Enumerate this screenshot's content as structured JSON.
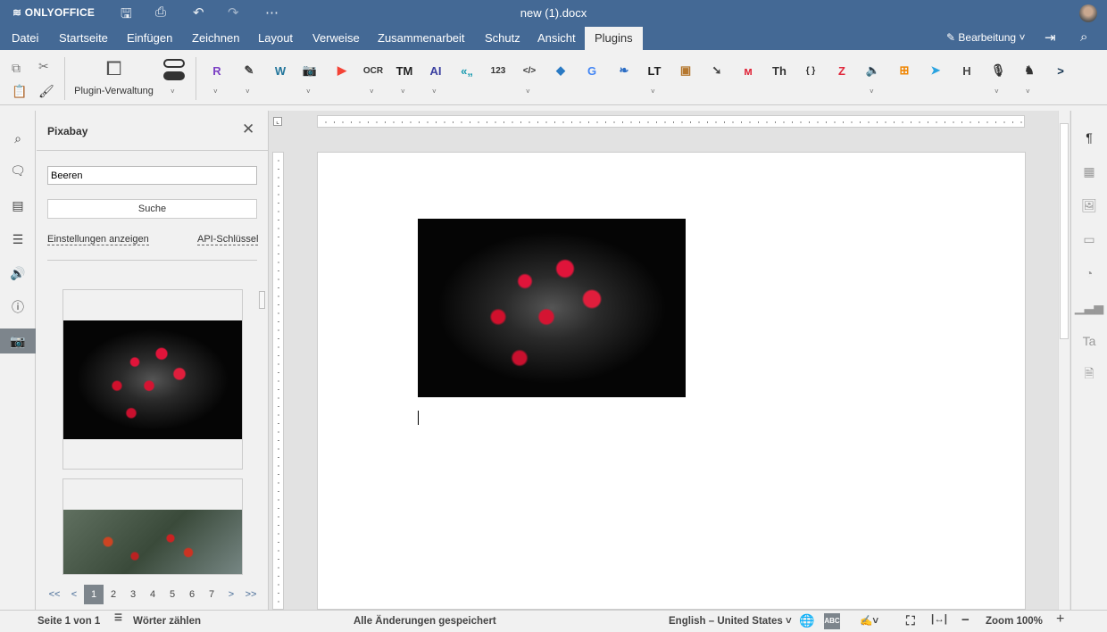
{
  "header": {
    "logo": "ONLYOFFICE",
    "title": "new (1).docx",
    "mode": "Bearbeitung"
  },
  "menu": [
    "Datei",
    "Startseite",
    "Einfügen",
    "Zeichnen",
    "Layout",
    "Verweise",
    "Zusammenarbeit",
    "Schutz",
    "Ansicht",
    "Plugins"
  ],
  "active_menu": "Plugins",
  "toolbar": {
    "plugin_manager": "Plugin-Verwaltung",
    "plugins": [
      {
        "name": "rainbow-r",
        "glyph": "R",
        "color": "#7b3fc4"
      },
      {
        "name": "photo-editor",
        "glyph": "✎",
        "color": "#444"
      },
      {
        "name": "wordpress",
        "glyph": "W",
        "color": "#21759b"
      },
      {
        "name": "camera",
        "glyph": "📷",
        "color": "#333"
      },
      {
        "name": "youtube",
        "glyph": "▶",
        "color": "#f44336"
      },
      {
        "name": "ocr",
        "glyph": "OCR",
        "color": "#333"
      },
      {
        "name": "translator-tm",
        "glyph": "TM",
        "color": "#222"
      },
      {
        "name": "ai",
        "glyph": "AI",
        "color": "#3a3fa0"
      },
      {
        "name": "typograf",
        "glyph": "«„",
        "color": "#1a9bb0"
      },
      {
        "name": "line-numbers",
        "glyph": "123",
        "color": "#333"
      },
      {
        "name": "macros-sync",
        "glyph": "</>",
        "color": "#333"
      },
      {
        "name": "apertium",
        "glyph": "◆",
        "color": "#2a7ac4"
      },
      {
        "name": "google-translate",
        "glyph": "G",
        "color": "#4285f4"
      },
      {
        "name": "deepl",
        "glyph": "❧",
        "color": "#2a6cc4"
      },
      {
        "name": "languagetool",
        "glyph": "LT",
        "color": "#222"
      },
      {
        "name": "box",
        "glyph": "▣",
        "color": "#b5772e"
      },
      {
        "name": "pipe",
        "glyph": "➘",
        "color": "#444"
      },
      {
        "name": "mendeley",
        "glyph": "ᴍ",
        "color": "#e0263a"
      },
      {
        "name": "thesaurus",
        "glyph": "Th",
        "color": "#333"
      },
      {
        "name": "code",
        "glyph": "{ }",
        "color": "#333"
      },
      {
        "name": "zotero",
        "glyph": "Z",
        "color": "#e0263a"
      },
      {
        "name": "speech",
        "glyph": "🔈",
        "color": "#333"
      },
      {
        "name": "drawio",
        "glyph": "⊞",
        "color": "#f08705"
      },
      {
        "name": "telegram",
        "glyph": "➤",
        "color": "#2aa3e0"
      },
      {
        "name": "html",
        "glyph": "H",
        "color": "#444"
      },
      {
        "name": "microphone",
        "glyph": "🎙",
        "color": "#333"
      },
      {
        "name": "chess",
        "glyph": "♞",
        "color": "#333"
      },
      {
        "name": "jitsi",
        "glyph": ">",
        "color": "#12324f"
      }
    ]
  },
  "panel": {
    "title": "Pixabay",
    "search_value": "Beeren",
    "search_button": "Suche",
    "show_settings": "Einstellungen anzeigen",
    "api_key": "API-Schlüssel",
    "pagination": [
      "<<",
      "<",
      "1",
      "2",
      "3",
      "4",
      "5",
      "6",
      "7",
      ">",
      ">>"
    ],
    "current_page": "1"
  },
  "status": {
    "page": "Seite 1 von 1",
    "word_count": "Wörter zählen",
    "saved": "Alle Änderungen gespeichert",
    "language": "English – United States",
    "zoom": "Zoom 100%"
  }
}
